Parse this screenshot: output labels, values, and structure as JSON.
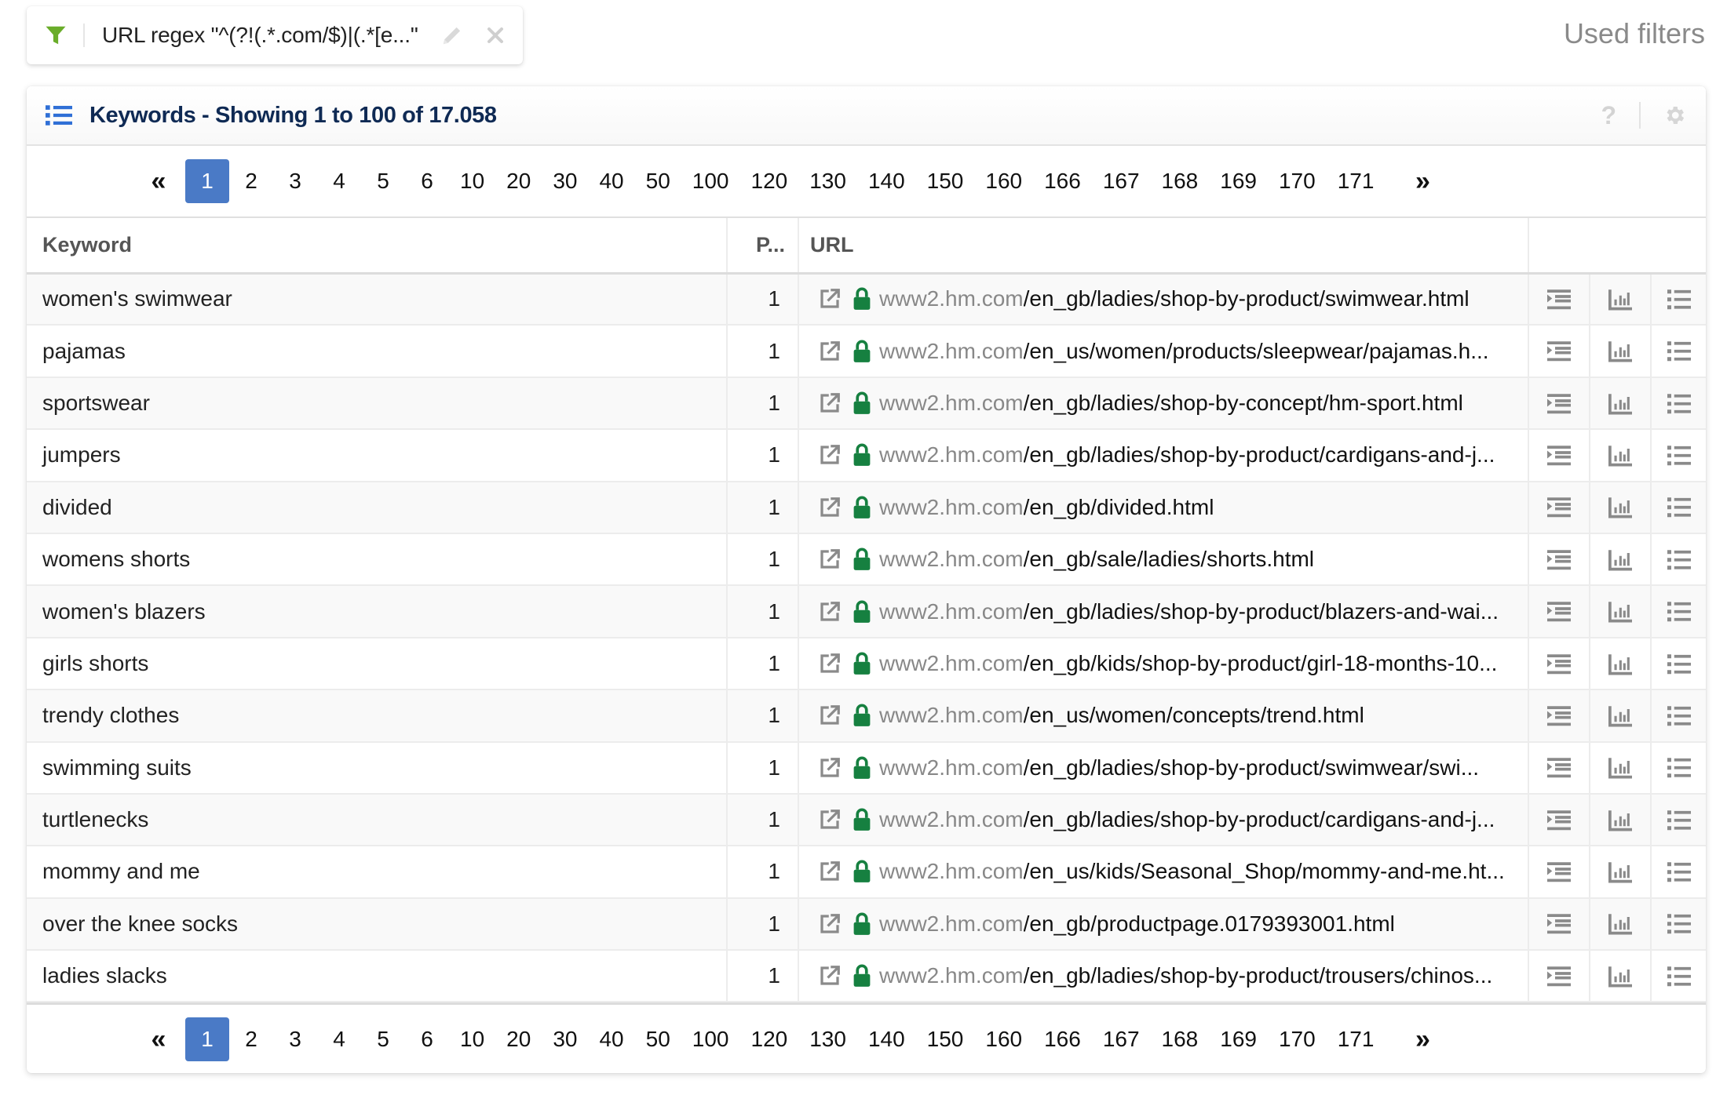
{
  "filter_chip": {
    "icon": "funnel-icon",
    "label": "URL regex \"^(?!(.*.com/$)|(.*[e...\"",
    "edit_icon": "pencil-icon",
    "remove_icon": "close-icon"
  },
  "used_filters_label": "Used filters",
  "card": {
    "title": "Keywords - Showing 1 to 100 of 17.058",
    "help_label": "?",
    "settings_icon": "gear-icon"
  },
  "pagination": {
    "first_label": "«",
    "last_label": "»",
    "active_page": "1",
    "pages": [
      "1",
      "2",
      "3",
      "4",
      "5",
      "6",
      "10",
      "20",
      "30",
      "40",
      "50",
      "100",
      "120",
      "130",
      "140",
      "150",
      "160",
      "166",
      "167",
      "168",
      "169",
      "170",
      "171"
    ]
  },
  "table": {
    "columns": {
      "keyword": "Keyword",
      "position": "P...",
      "url": "URL"
    },
    "rows": [
      {
        "keyword": "women's swimwear",
        "position": "1",
        "domain": "www2.hm.com",
        "path": "/en_gb/ladies/shop-by-product/swimwear.html"
      },
      {
        "keyword": "pajamas",
        "position": "1",
        "domain": "www2.hm.com",
        "path": "/en_us/women/products/sleepwear/pajamas.h..."
      },
      {
        "keyword": "sportswear",
        "position": "1",
        "domain": "www2.hm.com",
        "path": "/en_gb/ladies/shop-by-concept/hm-sport.html"
      },
      {
        "keyword": "jumpers",
        "position": "1",
        "domain": "www2.hm.com",
        "path": "/en_gb/ladies/shop-by-product/cardigans-and-j..."
      },
      {
        "keyword": "divided",
        "position": "1",
        "domain": "www2.hm.com",
        "path": "/en_gb/divided.html"
      },
      {
        "keyword": "womens shorts",
        "position": "1",
        "domain": "www2.hm.com",
        "path": "/en_gb/sale/ladies/shorts.html"
      },
      {
        "keyword": "women's blazers",
        "position": "1",
        "domain": "www2.hm.com",
        "path": "/en_gb/ladies/shop-by-product/blazers-and-wai..."
      },
      {
        "keyword": "girls shorts",
        "position": "1",
        "domain": "www2.hm.com",
        "path": "/en_gb/kids/shop-by-product/girl-18-months-10..."
      },
      {
        "keyword": "trendy clothes",
        "position": "1",
        "domain": "www2.hm.com",
        "path": "/en_us/women/concepts/trend.html"
      },
      {
        "keyword": "swimming suits",
        "position": "1",
        "domain": "www2.hm.com",
        "path": "/en_gb/ladies/shop-by-product/swimwear/swi..."
      },
      {
        "keyword": "turtlenecks",
        "position": "1",
        "domain": "www2.hm.com",
        "path": "/en_gb/ladies/shop-by-product/cardigans-and-j..."
      },
      {
        "keyword": "mommy and me",
        "position": "1",
        "domain": "www2.hm.com",
        "path": "/en_us/kids/Seasonal_Shop/mommy-and-me.ht..."
      },
      {
        "keyword": "over the knee socks",
        "position": "1",
        "domain": "www2.hm.com",
        "path": "/en_gb/productpage.0179393001.html"
      },
      {
        "keyword": "ladies slacks",
        "position": "1",
        "domain": "www2.hm.com",
        "path": "/en_gb/ladies/shop-by-product/trousers/chinos..."
      }
    ],
    "row_icons": {
      "external_link": "external-link-icon",
      "ssl": "lock-icon",
      "action_1": "indent-details-icon",
      "action_2": "bar-chart-icon",
      "action_3": "list-icon"
    }
  },
  "colors": {
    "accent_blue": "#4a7ac6",
    "title_navy": "#0f2a54",
    "filter_green": "#6aad2a",
    "lock_green": "#168040",
    "icon_gray": "#8a8a8a"
  }
}
